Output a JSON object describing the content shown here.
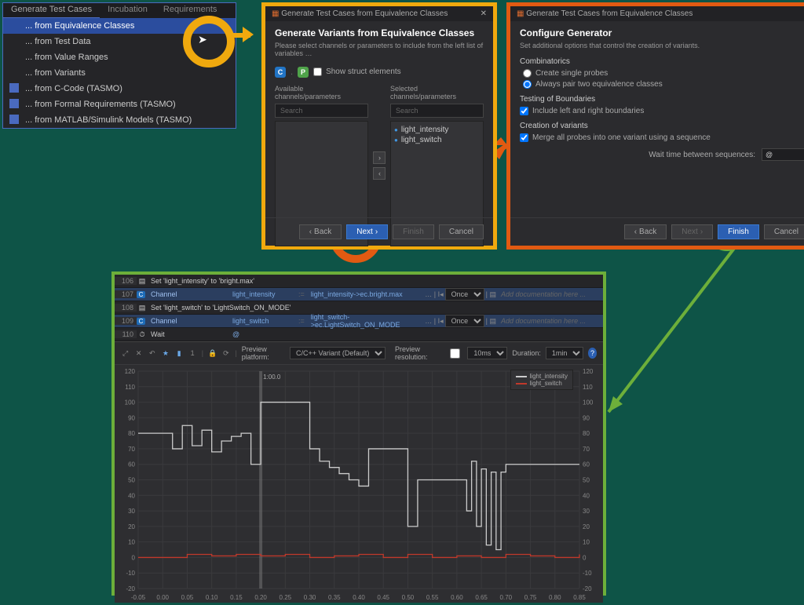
{
  "menu": {
    "tabs": [
      "Generate Test Cases",
      "Incubation",
      "Requirements"
    ],
    "items": [
      "... from Equivalence Classes",
      "... from Test Data",
      "... from Value Ranges",
      "... from Variants",
      "... from C-Code (TASMO)",
      "... from Formal Requirements (TASMO)",
      "... from MATLAB/Simulink Models (TASMO)"
    ]
  },
  "dlg1": {
    "title": "Generate Test Cases from Equivalence Classes",
    "close": "✕",
    "heading": "Generate Variants from Equivalence Classes",
    "sub": "Please select channels or parameters to include from the left list of variables …",
    "show_struct": "Show struct elements",
    "avail": "Available channels/parameters",
    "selected": "Selected channels/parameters",
    "search": "Search",
    "params": [
      "light_intensity",
      "light_switch"
    ],
    "back": "Back",
    "next": "Next",
    "finish": "Finish",
    "cancel": "Cancel"
  },
  "dlg2": {
    "title": "Generate Test Cases from Equivalence Classes",
    "close": "✕",
    "heading": "Configure Generator",
    "sub": "Set additional options that control the creation of variants.",
    "combinatorics": "Combinatorics",
    "r1": "Create single probes",
    "r2": "Always pair two equivalence classes",
    "testing": "Testing of Boundaries",
    "c1": "Include left and right boundaries",
    "creation": "Creation of variants",
    "c2": "Merge all probes into one variant using a sequence",
    "wait": "Wait time between sequences:",
    "back": "Back",
    "next": "Next",
    "finish": "Finish",
    "cancel": "Cancel"
  },
  "steps": [
    {
      "n": "106",
      "type": "set",
      "text": "Set 'light_intensity' to 'bright.max'"
    },
    {
      "n": "107",
      "type": "ch",
      "label": "Channel",
      "name": "light_intensity",
      "expr": "light_intensity->ec.bright.max",
      "mode": "Once",
      "doc": "Add documentation here ..."
    },
    {
      "n": "108",
      "type": "set",
      "text": "Set 'light_switch' to 'LightSwitch_ON_MODE'"
    },
    {
      "n": "109",
      "type": "ch",
      "label": "Channel",
      "name": "light_switch",
      "expr": "light_switch->ec.LightSwitch_ON_MODE",
      "mode": "Once",
      "doc": "Add documentation here ..."
    },
    {
      "n": "110",
      "type": "wait",
      "label": "Wait",
      "val": "@"
    }
  ],
  "plotHdr": {
    "preview_platform_label": "Preview platform:",
    "preview_platform": "C/C++ Variant (Default)",
    "preview_res_label": "Preview resolution:",
    "preview_res": "10ms",
    "duration_label": "Duration:",
    "duration": "1min"
  },
  "legend": {
    "s1": "light_intensity",
    "s2": "light_switch"
  },
  "chart_data": {
    "type": "line",
    "title": "",
    "xlabel": "",
    "ylabel": "",
    "xlim": [
      -0.05,
      0.85
    ],
    "ylim": [
      -20,
      120
    ],
    "xticks": [
      -0.05,
      0,
      0.05,
      0.1,
      0.15,
      0.2,
      0.25,
      0.3,
      0.35,
      0.4,
      0.45,
      0.5,
      0.55,
      0.6,
      0.65,
      0.7,
      0.75,
      0.8,
      0.85
    ],
    "yticks": [
      -20,
      -10,
      0,
      10,
      20,
      30,
      40,
      50,
      60,
      70,
      80,
      90,
      100,
      110,
      120
    ],
    "marker": "1:00.0",
    "series": [
      {
        "name": "light_intensity",
        "color": "#cccccc",
        "step": true,
        "x": [
          -0.05,
          0.0,
          0.02,
          0.04,
          0.06,
          0.08,
          0.1,
          0.12,
          0.14,
          0.16,
          0.18,
          0.2,
          0.28,
          0.3,
          0.32,
          0.34,
          0.36,
          0.38,
          0.4,
          0.42,
          0.48,
          0.5,
          0.52,
          0.6,
          0.62,
          0.63,
          0.64,
          0.65,
          0.66,
          0.67,
          0.68,
          0.69,
          0.7,
          0.78,
          0.85
        ],
        "y": [
          80,
          80,
          70,
          85,
          72,
          82,
          68,
          75,
          78,
          80,
          60,
          100,
          100,
          70,
          62,
          58,
          54,
          50,
          46,
          70,
          70,
          20,
          50,
          50,
          30,
          62,
          20,
          57,
          8,
          55,
          5,
          55,
          60,
          60,
          60
        ]
      },
      {
        "name": "light_switch",
        "color": "#c0392b",
        "step": true,
        "x": [
          -0.05,
          0.05,
          0.1,
          0.15,
          0.2,
          0.25,
          0.3,
          0.35,
          0.4,
          0.45,
          0.5,
          0.55,
          0.6,
          0.65,
          0.7,
          0.75,
          0.8,
          0.85
        ],
        "y": [
          0,
          2,
          1,
          2,
          1,
          2,
          0,
          1,
          2,
          0,
          2,
          0,
          1,
          0,
          2,
          1,
          0,
          2
        ]
      }
    ]
  }
}
